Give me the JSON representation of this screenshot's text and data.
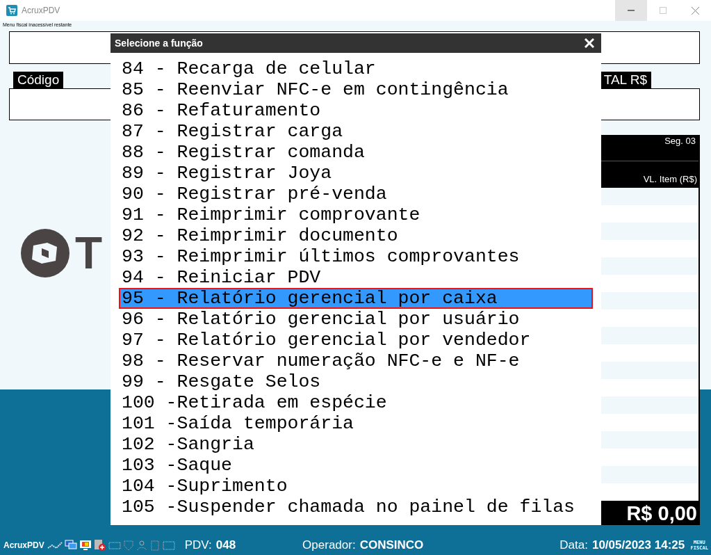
{
  "window": {
    "title": "AcruxPDV"
  },
  "notice": "Menu fiscal inacessível restante",
  "code_field": {
    "label": "Código"
  },
  "total_field": {
    "label": "TAL R$"
  },
  "logo_text": "T",
  "items_panel": {
    "segment": "Seg. 03",
    "column": "VL. Item (R$)",
    "total": "R$ 0,00"
  },
  "dialog": {
    "title": "Selecione a função",
    "items": [
      {
        "label": "84 - Recarga de celular",
        "selected": false
      },
      {
        "label": "85 - Reenviar NFC-e em contingência",
        "selected": false
      },
      {
        "label": "86 - Refaturamento",
        "selected": false
      },
      {
        "label": "87 - Registrar carga",
        "selected": false
      },
      {
        "label": "88 - Registrar comanda",
        "selected": false
      },
      {
        "label": "89 - Registrar Joya",
        "selected": false
      },
      {
        "label": "90 - Registrar pré-venda",
        "selected": false
      },
      {
        "label": "91 - Reimprimir comprovante",
        "selected": false
      },
      {
        "label": "92 - Reimprimir documento",
        "selected": false
      },
      {
        "label": "93 - Reimprimir últimos comprovantes",
        "selected": false
      },
      {
        "label": "94 - Reiniciar PDV",
        "selected": false
      },
      {
        "label": "95 - Relatório gerencial por caixa",
        "selected": true
      },
      {
        "label": "96 - Relatório gerencial por usuário",
        "selected": false
      },
      {
        "label": "97 - Relatório gerencial por vendedor",
        "selected": false
      },
      {
        "label": "98 - Reservar numeração NFC-e e NF-e",
        "selected": false
      },
      {
        "label": "99 - Resgate Selos",
        "selected": false
      },
      {
        "label": "100 -Retirada em espécie",
        "selected": false
      },
      {
        "label": "101 -Saída temporária",
        "selected": false
      },
      {
        "label": "102 -Sangria",
        "selected": false
      },
      {
        "label": "103 -Saque",
        "selected": false
      },
      {
        "label": "104 -Suprimento",
        "selected": false
      },
      {
        "label": "105 -Suspender chamada no painel de filas",
        "selected": false
      }
    ]
  },
  "status_bar": {
    "app": "AcruxPDV",
    "pdv_label": "PDV:",
    "pdv": "048",
    "operator_label": "Operador:",
    "operator": "CONSINCO",
    "date_label": "Data:",
    "date": "10/05/2023 14:25",
    "menu_fiscal": "MENU FISCAL"
  }
}
